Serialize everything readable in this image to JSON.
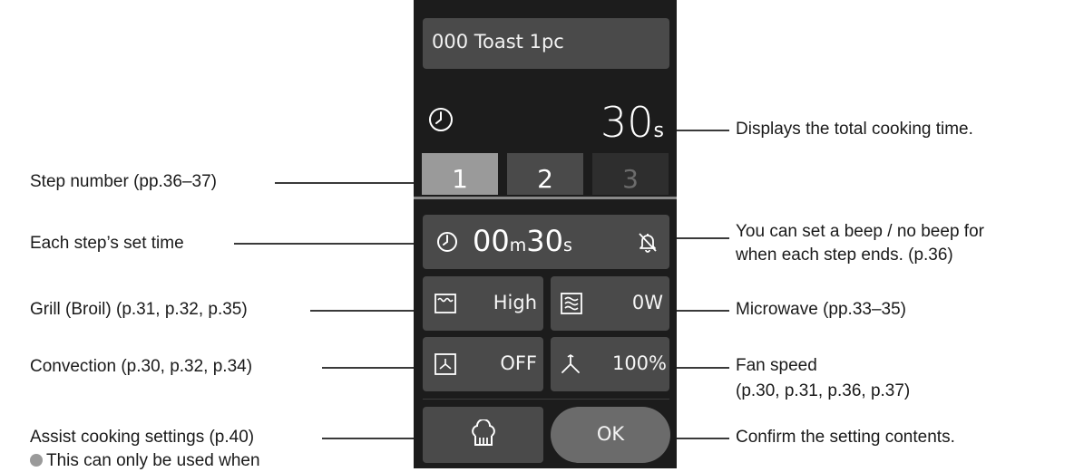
{
  "screen": {
    "program_title": "000 Toast 1pc",
    "total_time_value": "30",
    "total_time_unit": "s",
    "steps": [
      {
        "label": "1",
        "state": "selected"
      },
      {
        "label": "2",
        "state": "available"
      },
      {
        "label": "3",
        "state": "disabled"
      }
    ],
    "step_time": {
      "minutes": "00",
      "minutes_unit": "m",
      "seconds": "30",
      "seconds_unit": "s"
    },
    "grill_value": "High",
    "microwave_value": "0W",
    "convection_value": "OFF",
    "fan_speed_value": "100%",
    "ok_label": "OK"
  },
  "callouts": {
    "total_time": "Displays the total cooking time.",
    "step_number": "Step number (pp.36–37)",
    "step_time": "Each step’s set time",
    "beep_line1": "You can set a beep / no beep for",
    "beep_line2": "when each step ends. (p.36)",
    "grill": "Grill (Broil) (p.31, p.32, p.35)",
    "microwave": "Microwave (pp.33–35)",
    "convection": "Convection (p.30, p.32, p.34)",
    "fan_line1": "Fan speed",
    "fan_line2": "(p.30, p.31, p.36, p.37)",
    "assist": "Assist cooking settings (p.40)",
    "confirm": "Confirm the setting contents.",
    "note": "This can only be used when"
  },
  "colors": {
    "panel_background": "#1c1c1c",
    "box_background": "#4a4a4a",
    "selected_step": "#9a9a9a",
    "ok_button": "#6b6b6b"
  },
  "icons": {
    "total_time": "clock-icon",
    "step_time": "clock-icon",
    "beep": "bell-off-icon",
    "grill": "grill-icon",
    "microwave": "microwave-icon",
    "convection": "convection-icon",
    "fan": "fan-icon",
    "assist": "chef-hat-icon"
  }
}
